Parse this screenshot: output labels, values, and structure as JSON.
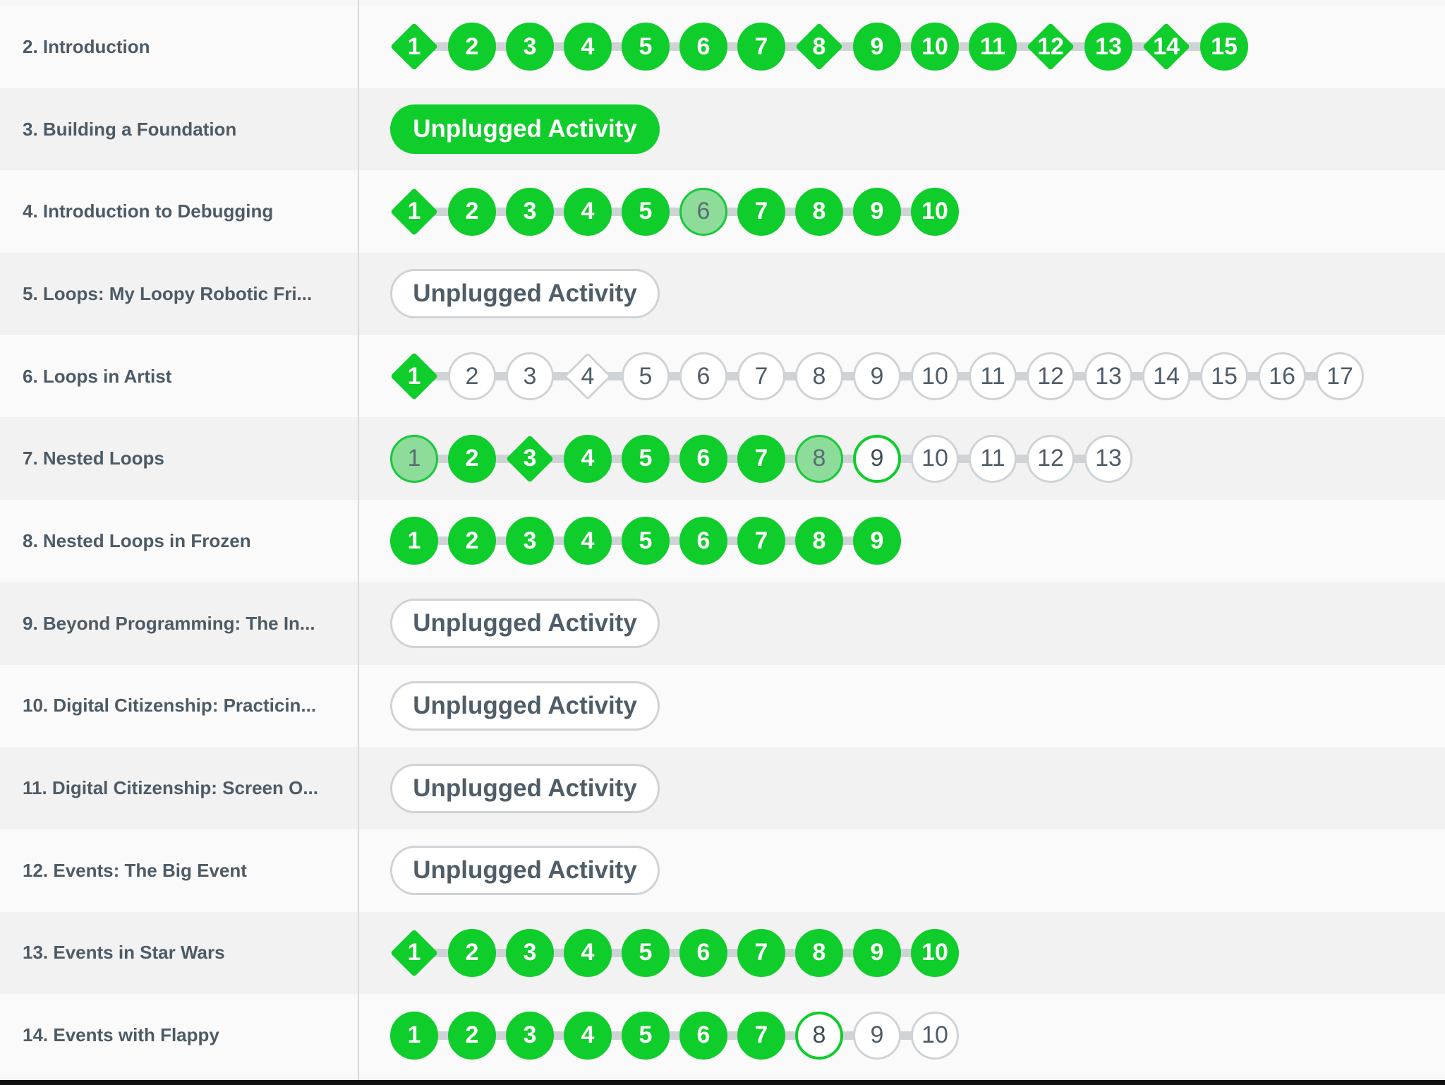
{
  "rows": [
    {
      "name": "2. Introduction",
      "levels": [
        {
          "n": "1",
          "s": "complete",
          "d": true
        },
        {
          "n": "2",
          "s": "complete"
        },
        {
          "n": "3",
          "s": "complete"
        },
        {
          "n": "4",
          "s": "complete"
        },
        {
          "n": "5",
          "s": "complete"
        },
        {
          "n": "6",
          "s": "complete"
        },
        {
          "n": "7",
          "s": "complete"
        },
        {
          "n": "8",
          "s": "complete",
          "d": true
        },
        {
          "n": "9",
          "s": "complete"
        },
        {
          "n": "10",
          "s": "complete"
        },
        {
          "n": "11",
          "s": "complete"
        },
        {
          "n": "12",
          "s": "complete",
          "d": true
        },
        {
          "n": "13",
          "s": "complete"
        },
        {
          "n": "14",
          "s": "complete",
          "d": true
        },
        {
          "n": "15",
          "s": "complete"
        }
      ]
    },
    {
      "name": "3. Building a Foundation",
      "pill": {
        "label": "Unplugged Activity",
        "s": "complete"
      }
    },
    {
      "name": "4. Introduction to Debugging",
      "levels": [
        {
          "n": "1",
          "s": "complete",
          "d": true
        },
        {
          "n": "2",
          "s": "complete"
        },
        {
          "n": "3",
          "s": "complete"
        },
        {
          "n": "4",
          "s": "complete"
        },
        {
          "n": "5",
          "s": "complete"
        },
        {
          "n": "6",
          "s": "partial"
        },
        {
          "n": "7",
          "s": "complete"
        },
        {
          "n": "8",
          "s": "complete"
        },
        {
          "n": "9",
          "s": "complete"
        },
        {
          "n": "10",
          "s": "complete"
        }
      ]
    },
    {
      "name": "5. Loops: My Loopy Robotic Fri...",
      "pill": {
        "label": "Unplugged Activity",
        "s": "notstarted"
      }
    },
    {
      "name": "6. Loops in Artist",
      "levels": [
        {
          "n": "1",
          "s": "complete",
          "d": true
        },
        {
          "n": "2",
          "s": "notstarted"
        },
        {
          "n": "3",
          "s": "notstarted"
        },
        {
          "n": "4",
          "s": "notstarted",
          "d": true
        },
        {
          "n": "5",
          "s": "notstarted"
        },
        {
          "n": "6",
          "s": "notstarted"
        },
        {
          "n": "7",
          "s": "notstarted"
        },
        {
          "n": "8",
          "s": "notstarted"
        },
        {
          "n": "9",
          "s": "notstarted"
        },
        {
          "n": "10",
          "s": "notstarted"
        },
        {
          "n": "11",
          "s": "notstarted"
        },
        {
          "n": "12",
          "s": "notstarted"
        },
        {
          "n": "13",
          "s": "notstarted"
        },
        {
          "n": "14",
          "s": "notstarted"
        },
        {
          "n": "15",
          "s": "notstarted"
        },
        {
          "n": "16",
          "s": "notstarted"
        },
        {
          "n": "17",
          "s": "notstarted"
        }
      ]
    },
    {
      "name": "7. Nested Loops",
      "levels": [
        {
          "n": "1",
          "s": "partial"
        },
        {
          "n": "2",
          "s": "complete"
        },
        {
          "n": "3",
          "s": "complete",
          "d": true
        },
        {
          "n": "4",
          "s": "complete"
        },
        {
          "n": "5",
          "s": "complete"
        },
        {
          "n": "6",
          "s": "complete"
        },
        {
          "n": "7",
          "s": "complete"
        },
        {
          "n": "8",
          "s": "partial"
        },
        {
          "n": "9",
          "s": "attempted"
        },
        {
          "n": "10",
          "s": "notstarted"
        },
        {
          "n": "11",
          "s": "notstarted"
        },
        {
          "n": "12",
          "s": "notstarted"
        },
        {
          "n": "13",
          "s": "notstarted"
        }
      ]
    },
    {
      "name": "8. Nested Loops in Frozen",
      "levels": [
        {
          "n": "1",
          "s": "complete"
        },
        {
          "n": "2",
          "s": "complete"
        },
        {
          "n": "3",
          "s": "complete"
        },
        {
          "n": "4",
          "s": "complete"
        },
        {
          "n": "5",
          "s": "complete"
        },
        {
          "n": "6",
          "s": "complete"
        },
        {
          "n": "7",
          "s": "complete"
        },
        {
          "n": "8",
          "s": "complete"
        },
        {
          "n": "9",
          "s": "complete"
        }
      ]
    },
    {
      "name": "9. Beyond Programming: The In...",
      "pill": {
        "label": "Unplugged Activity",
        "s": "notstarted"
      }
    },
    {
      "name": "10. Digital Citizenship: Practicin...",
      "pill": {
        "label": "Unplugged Activity",
        "s": "notstarted"
      }
    },
    {
      "name": "11. Digital Citizenship: Screen O...",
      "pill": {
        "label": "Unplugged Activity",
        "s": "notstarted"
      }
    },
    {
      "name": "12. Events: The Big Event",
      "pill": {
        "label": "Unplugged Activity",
        "s": "notstarted"
      }
    },
    {
      "name": "13. Events in Star Wars",
      "levels": [
        {
          "n": "1",
          "s": "complete",
          "d": true
        },
        {
          "n": "2",
          "s": "complete"
        },
        {
          "n": "3",
          "s": "complete"
        },
        {
          "n": "4",
          "s": "complete"
        },
        {
          "n": "5",
          "s": "complete"
        },
        {
          "n": "6",
          "s": "complete"
        },
        {
          "n": "7",
          "s": "complete"
        },
        {
          "n": "8",
          "s": "complete"
        },
        {
          "n": "9",
          "s": "complete"
        },
        {
          "n": "10",
          "s": "complete"
        }
      ]
    },
    {
      "name": "14. Events with Flappy",
      "levels": [
        {
          "n": "1",
          "s": "complete"
        },
        {
          "n": "2",
          "s": "complete"
        },
        {
          "n": "3",
          "s": "complete"
        },
        {
          "n": "4",
          "s": "complete"
        },
        {
          "n": "5",
          "s": "complete"
        },
        {
          "n": "6",
          "s": "complete"
        },
        {
          "n": "7",
          "s": "complete"
        },
        {
          "n": "8",
          "s": "attempted"
        },
        {
          "n": "9",
          "s": "notstarted"
        },
        {
          "n": "10",
          "s": "notstarted"
        }
      ]
    }
  ]
}
